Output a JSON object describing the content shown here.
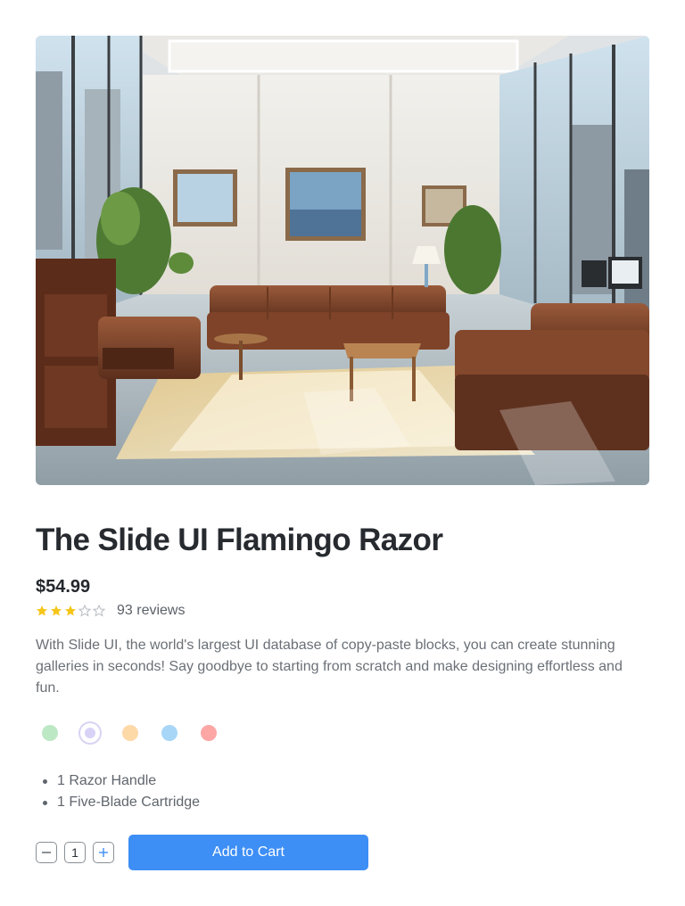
{
  "product": {
    "title": "The Slide UI Flamingo Razor",
    "price": "$54.99",
    "rating": 3,
    "rating_max": 5,
    "reviews_label": "93 reviews",
    "description": "With Slide UI, the world's largest UI database of copy-paste blocks, you can create stunning galleries in seconds! Say goodbye to starting from scratch and make designing effortless and fun.",
    "colors": [
      "#bde8c4",
      "#d9d2f7",
      "#fdd9a8",
      "#a8d6f7",
      "#fca6a6"
    ],
    "selected_color_index": 1,
    "features": [
      "1 Razor Handle",
      "1 Five-Blade Cartridge"
    ]
  },
  "quantity": {
    "value": "1"
  },
  "actions": {
    "add_to_cart_label": "Add to Cart"
  },
  "theme": {
    "accent": "#3d8ef5",
    "star_filled": "#f5c518",
    "star_empty": "#b8bcc1"
  }
}
